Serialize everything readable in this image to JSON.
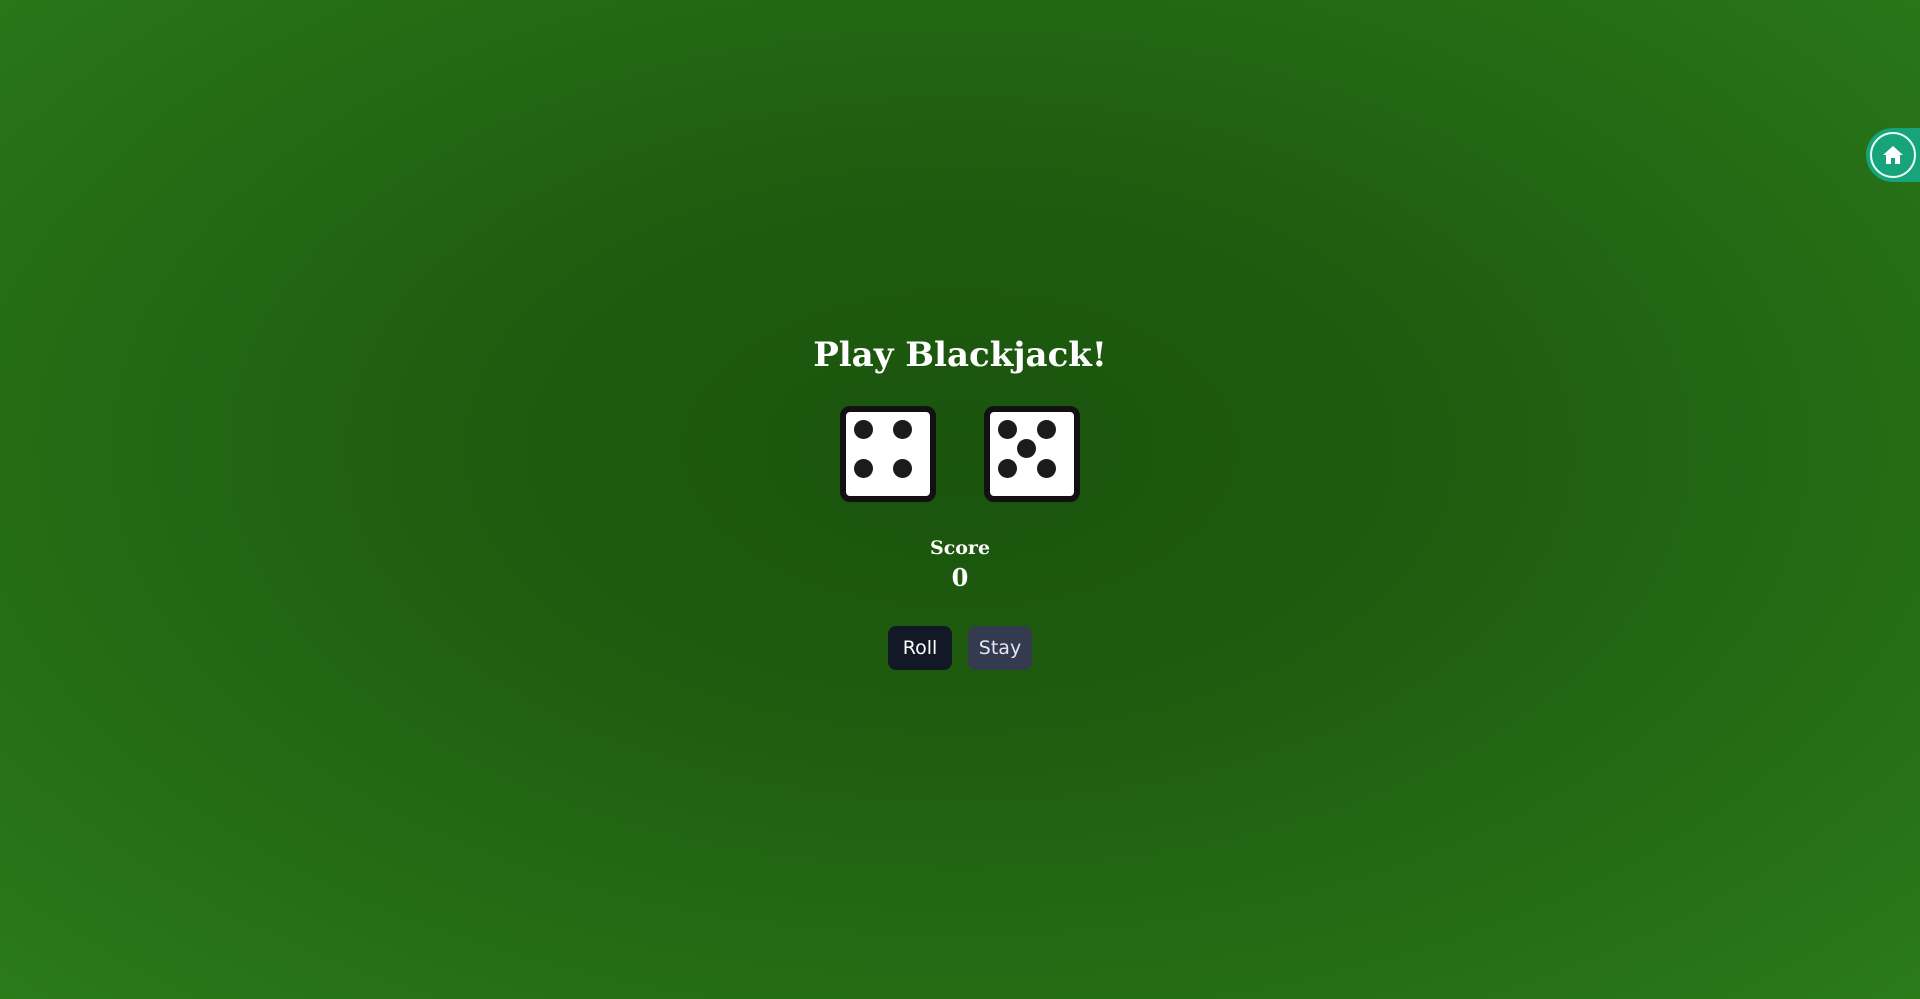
{
  "home": {
    "icon": "home-icon",
    "accent_color": "#17a47a"
  },
  "game": {
    "title": "Play Blackjack!",
    "dice": [
      4,
      5
    ],
    "score_label": "Score",
    "score_value": "0",
    "roll_label": "Roll",
    "stay_label": "Stay"
  },
  "colors": {
    "felt": "#1f5c0f",
    "roll_button": "#121826",
    "stay_button": "#343a50"
  }
}
